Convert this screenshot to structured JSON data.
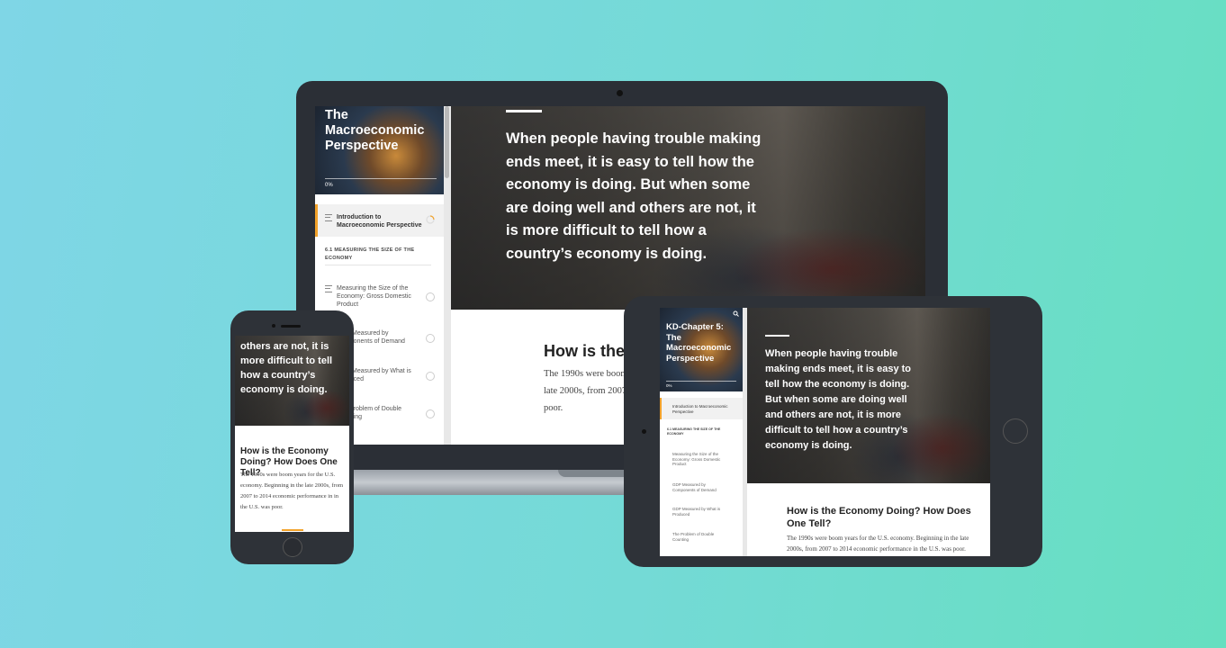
{
  "laptop": {
    "sidebar": {
      "title": "The Macroeconomic Perspective",
      "progress": "0%",
      "items": [
        {
          "label": "Introduction to Macroeconomic Perspective"
        },
        {
          "label": "6.1 MEASURING THE SIZE OF THE ECONOMY"
        },
        {
          "label": "Measuring the Size of the Economy: Gross Domestic Product"
        },
        {
          "label": "GDP Measured by Components of Demand"
        },
        {
          "label": "GDP Measured by What is Produced"
        },
        {
          "label": "The Problem of Double Counting"
        }
      ]
    },
    "quote": "When people having trouble making ends meet, it is easy to tell how the economy is doing. But when some are doing well and others are not, it is more difficult to tell how a country’s economy is doing.",
    "heading": "How is the Economy Doing? How Does One Tell?",
    "body": "The 1990s were boom years for the U.S. economy. Beginning in the late 2000s, from 2007 to 2014 economic performance in the U.S. was poor."
  },
  "phone": {
    "quote_tail": "others are not, it is more difficult to tell how a country’s economy is doing.",
    "heading": "How is the Economy Doing? How Does One Tell?",
    "body": "The 1990s were boom years for the U.S. economy. Beginning in the late 2000s, from 2007 to 2014 economic performance in in the U.S. was poor."
  },
  "tablet": {
    "sidebar": {
      "title": "KD-Chapter 5: The Macroeconomic Perspective",
      "progress": "0%",
      "items": [
        {
          "label": "Introduction to Macroeconomic Perspective"
        },
        {
          "label": "6.1 MEASURING THE SIZE OF THE ECONOMY"
        },
        {
          "label": "Measuring the Size of the Economy: Gross Domestic Product"
        },
        {
          "label": "GDP Measured by Components of Demand"
        },
        {
          "label": "GDP Measured by What is Produced"
        },
        {
          "label": "The Problem of Double Counting"
        }
      ]
    },
    "quote": "When people having trouble making ends meet, it is easy to tell how the economy is doing. But when some are doing well and others are not, it is more difficult to tell how a country’s economy is doing.",
    "heading": "How is the Economy Doing? How Does One Tell?",
    "body": "The 1990s were boom years for the U.S. economy. Beginning in the late 2000s, from 2007 to 2014 economic performance in the U.S. was poor."
  },
  "colors": {
    "accent": "#f2a22a",
    "background": "#74dad6"
  },
  "icons": [
    "menu-lines-icon",
    "circle-status-icon",
    "search-icon",
    "progress-ring-icon"
  ]
}
